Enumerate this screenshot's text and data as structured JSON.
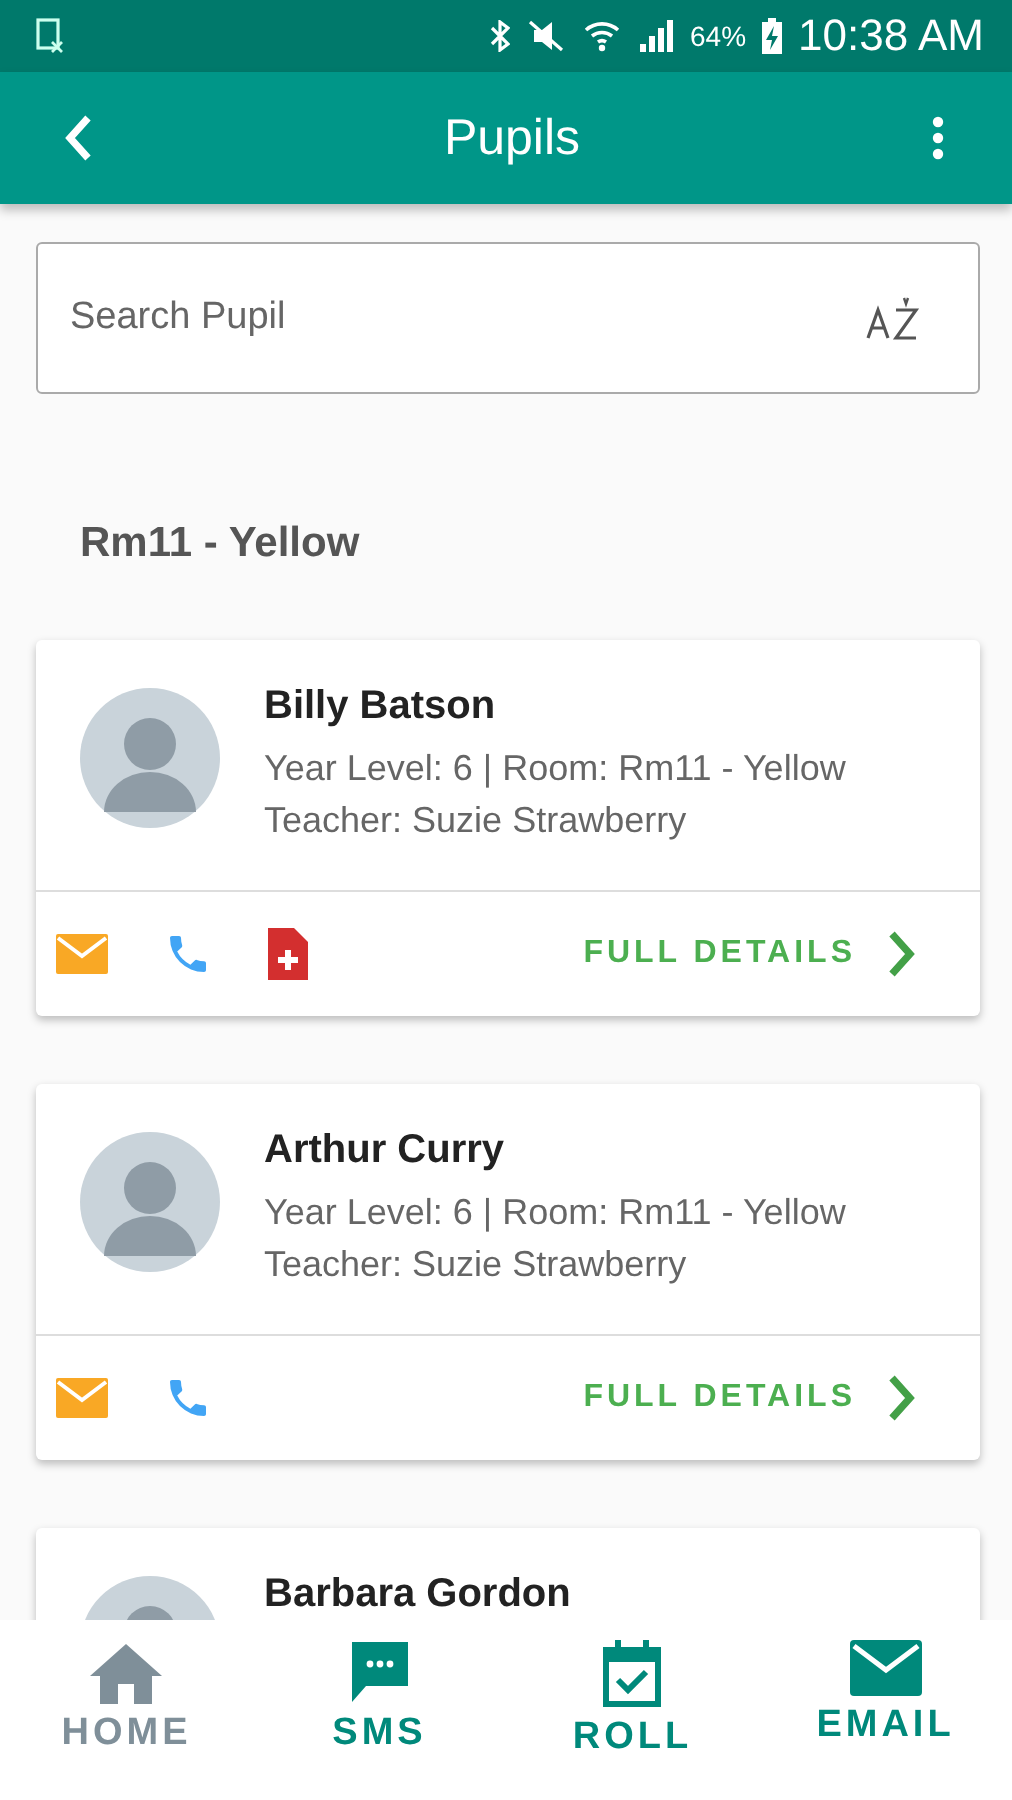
{
  "status_bar": {
    "battery": "64%",
    "time": "10:38 AM"
  },
  "app_bar": {
    "title": "Pupils"
  },
  "search": {
    "placeholder": "Search Pupil"
  },
  "section": "Rm11 - Yellow",
  "pupils": [
    {
      "name": "Billy Batson",
      "info": "Year Level: 6 | Room: Rm11 - Yellow",
      "teacher": "Teacher: Suzie Strawberry",
      "actions": [
        {
          "kind": "email"
        },
        {
          "kind": "phone"
        },
        {
          "kind": "medical"
        }
      ],
      "link": "FULL DETAILS"
    },
    {
      "name": "Arthur Curry",
      "info": "Year Level: 6 | Room: Rm11 - Yellow",
      "teacher": "Teacher: Suzie Strawberry",
      "actions": [
        {
          "kind": "email"
        },
        {
          "kind": "phone"
        }
      ],
      "link": "FULL DETAILS"
    },
    {
      "name": "Barbara Gordon"
    }
  ],
  "bottom_nav": [
    {
      "kind": "home",
      "label": "HOME",
      "dimmed": true
    },
    {
      "kind": "sms",
      "label": "SMS",
      "dimmed": false
    },
    {
      "kind": "roll",
      "label": "ROLL",
      "dimmed": false
    },
    {
      "kind": "email",
      "label": "EMAIL",
      "dimmed": false
    }
  ]
}
